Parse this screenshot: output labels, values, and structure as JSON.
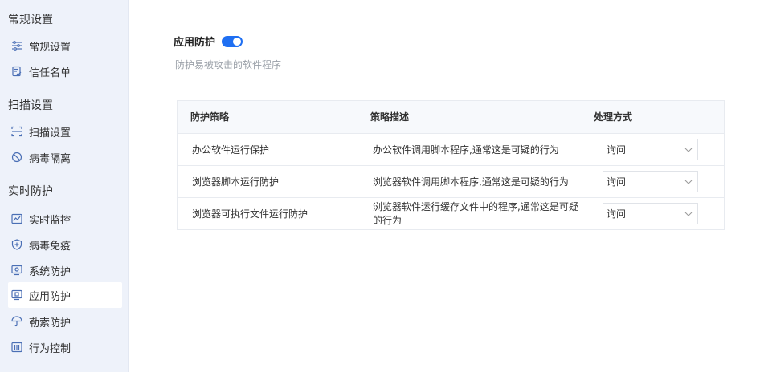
{
  "sidebar": {
    "groups": [
      {
        "title": "常规设置",
        "items": [
          {
            "label": "常规设置",
            "icon": "sliders-icon"
          },
          {
            "label": "信任名单",
            "icon": "trust-list-icon"
          }
        ]
      },
      {
        "title": "扫描设置",
        "items": [
          {
            "label": "扫描设置",
            "icon": "scan-icon"
          },
          {
            "label": "病毒隔离",
            "icon": "quarantine-icon"
          }
        ]
      },
      {
        "title": "实时防护",
        "items": [
          {
            "label": "实时监控",
            "icon": "monitor-chart-icon"
          },
          {
            "label": "病毒免疫",
            "icon": "shield-plus-icon"
          },
          {
            "label": "系统防护",
            "icon": "system-protect-icon"
          },
          {
            "label": "应用防护",
            "icon": "app-protect-icon",
            "active": true
          },
          {
            "label": "勒索防护",
            "icon": "umbrella-icon"
          },
          {
            "label": "行为控制",
            "icon": "behavior-control-icon"
          }
        ]
      }
    ]
  },
  "main": {
    "title": "应用防护",
    "toggle_on": true,
    "description": "防护易被攻击的软件程序",
    "accent_color": "#1f6ff2",
    "table": {
      "headers": [
        "防护策略",
        "策略描述",
        "处理方式"
      ],
      "rows": [
        {
          "name": "办公软件运行保护",
          "desc": "办公软件调用脚本程序,通常这是可疑的行为",
          "action": "询问"
        },
        {
          "name": "浏览器脚本运行防护",
          "desc": "浏览器软件调用脚本程序,通常这是可疑的行为",
          "action": "询问"
        },
        {
          "name": "浏览器可执行文件运行防护",
          "desc": "浏览器软件运行缓存文件中的程序,通常这是可疑的行为",
          "action": "询问"
        }
      ]
    }
  }
}
